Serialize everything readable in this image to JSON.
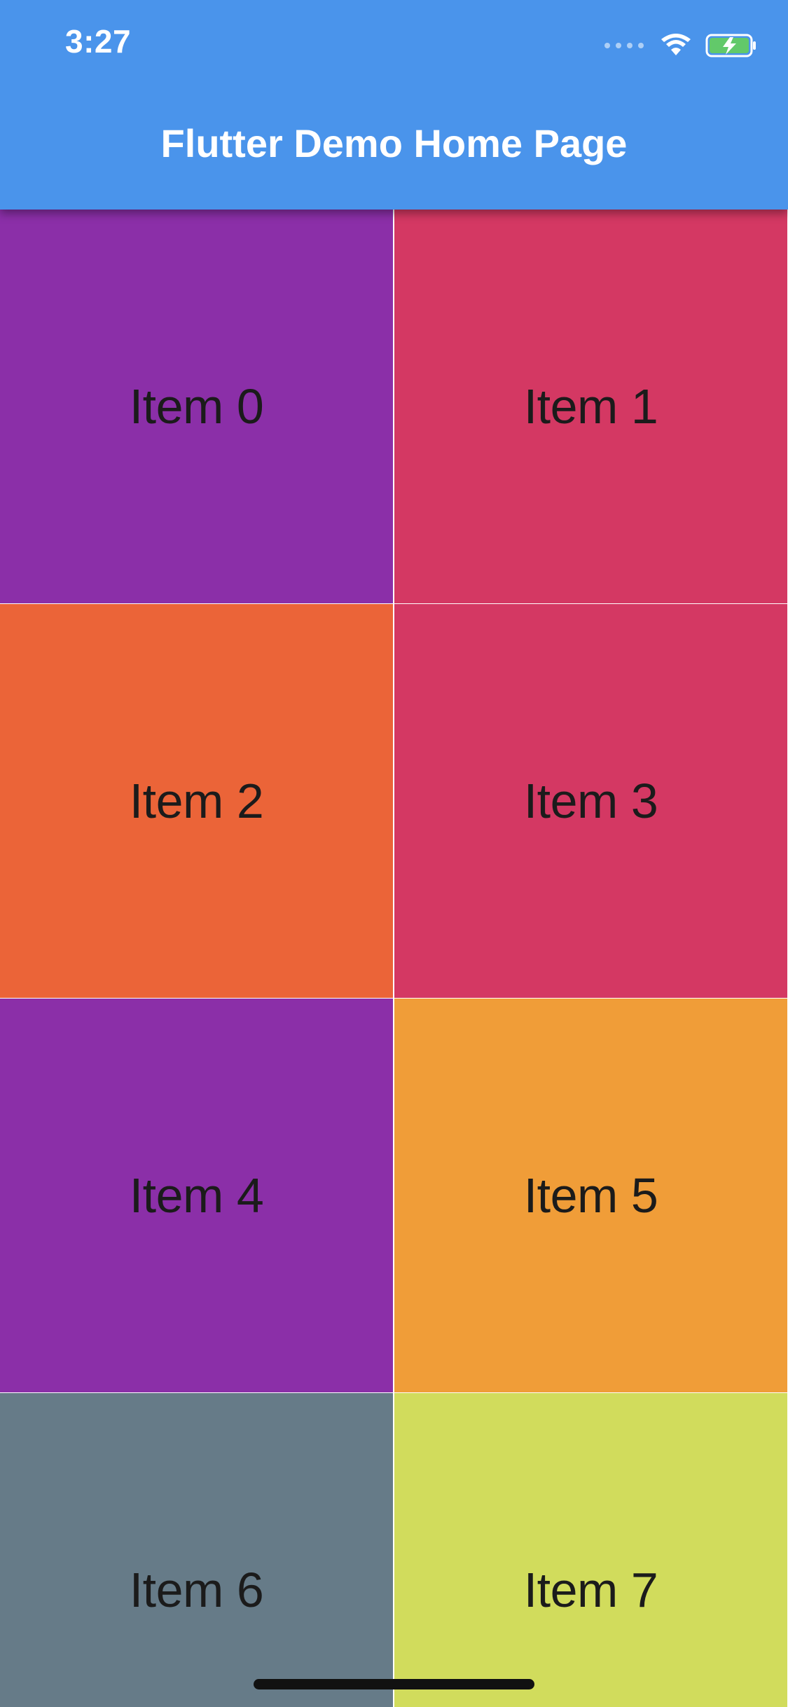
{
  "status_bar": {
    "time": "3:27",
    "background_color": "#4a94eb",
    "icons": [
      "cellular-dots-icon",
      "wifi-icon",
      "battery-charging-icon"
    ]
  },
  "app_bar": {
    "title": "Flutter Demo Home Page",
    "background_color": "#4a94eb"
  },
  "grid": {
    "items": [
      {
        "label": "Item 0",
        "color": "#8b2fa8"
      },
      {
        "label": "Item 1",
        "color": "#d43863"
      },
      {
        "label": "Item 2",
        "color": "#eb6438"
      },
      {
        "label": "Item 3",
        "color": "#d43863"
      },
      {
        "label": "Item 4",
        "color": "#8b2fa8"
      },
      {
        "label": "Item 5",
        "color": "#f09d38"
      },
      {
        "label": "Item 6",
        "color": "#667b88"
      },
      {
        "label": "Item 7",
        "color": "#d1dc5c"
      }
    ]
  }
}
